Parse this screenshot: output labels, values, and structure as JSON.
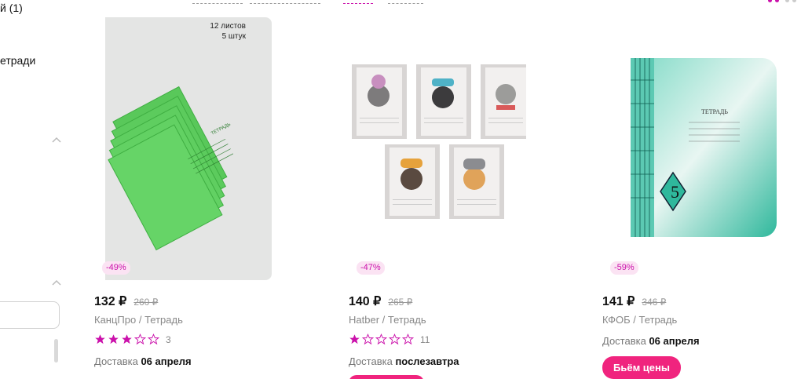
{
  "sidebar": {
    "item_count_text": "й (1)",
    "item_notebooks": "етради"
  },
  "colors": {
    "accent": "#cb11ab",
    "button": "#f0247e",
    "badge_bg": "#fbe3f3"
  },
  "products": [
    {
      "discount": "-49%",
      "price": "132 ₽",
      "old_price": "260 ₽",
      "brand": "КанцПро / Тетрадь",
      "rating": 3,
      "reviews": "3",
      "delivery_label": "Доставка",
      "delivery_date": "06 апреля",
      "image_caption_1": "12 листов",
      "image_caption_2": "5 штук",
      "image_label": "ТЕТРАДЬ"
    },
    {
      "discount": "-47%",
      "price": "140 ₽",
      "old_price": "265 ₽",
      "brand": "Hatber / Тетрадь",
      "rating": 1,
      "reviews": "11",
      "delivery_label": "Доставка",
      "delivery_date": "послезавтра"
    },
    {
      "discount": "-59%",
      "price": "141 ₽",
      "old_price": "346 ₽",
      "brand": "КФОБ / Тетрадь",
      "delivery_label": "Доставка",
      "delivery_date": "06 апреля",
      "button_label": "Бьём цены",
      "image_label": "ТЕТРАДЬ"
    }
  ]
}
